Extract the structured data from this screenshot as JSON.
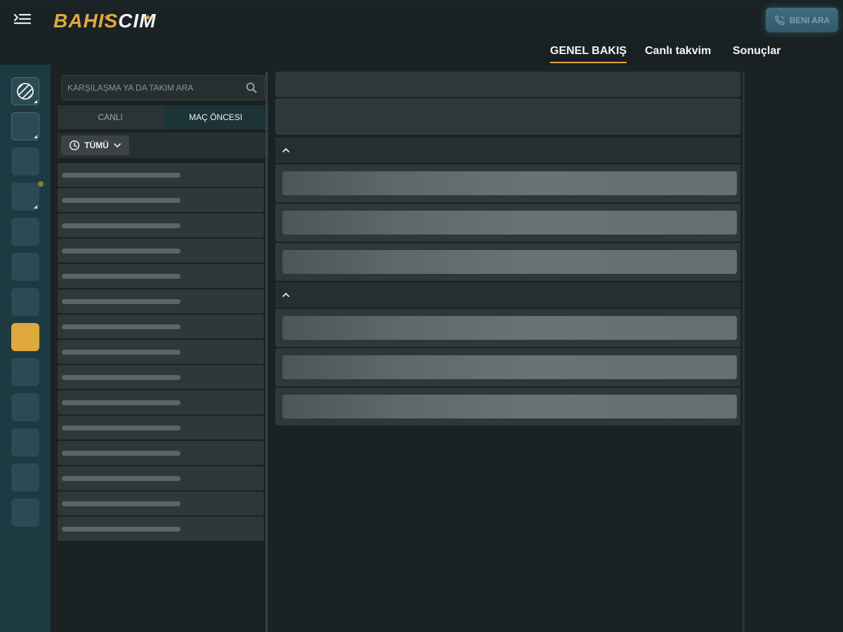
{
  "header": {
    "logo_part1": "BAHIS",
    "logo_part2": "CIM",
    "call_button_label": "BENI ARA",
    "tabs": [
      {
        "label": "GENEL BAKIŞ",
        "active": true
      },
      {
        "label": "Canlı takvim",
        "active": false
      },
      {
        "label": "Sonuçlar",
        "active": false
      }
    ]
  },
  "search": {
    "placeholder": "KARŞILAŞMA YA DA TAKIM ARA",
    "value": ""
  },
  "mode_tabs": {
    "live_label": "CANLI",
    "prematch_label": "MAÇ ÖNCESI",
    "selected": "prematch"
  },
  "filter": {
    "label": "TÜMÜ",
    "icon": "clock-icon"
  },
  "colors": {
    "accent": "#e0a93d",
    "rail_bg": "#1d3a43",
    "page_bg": "#1b2224"
  },
  "icons": {
    "menu": "menu-toggle-icon",
    "search": "search-icon",
    "phone": "phone-icon",
    "collapse": "chevron-up-icon"
  }
}
